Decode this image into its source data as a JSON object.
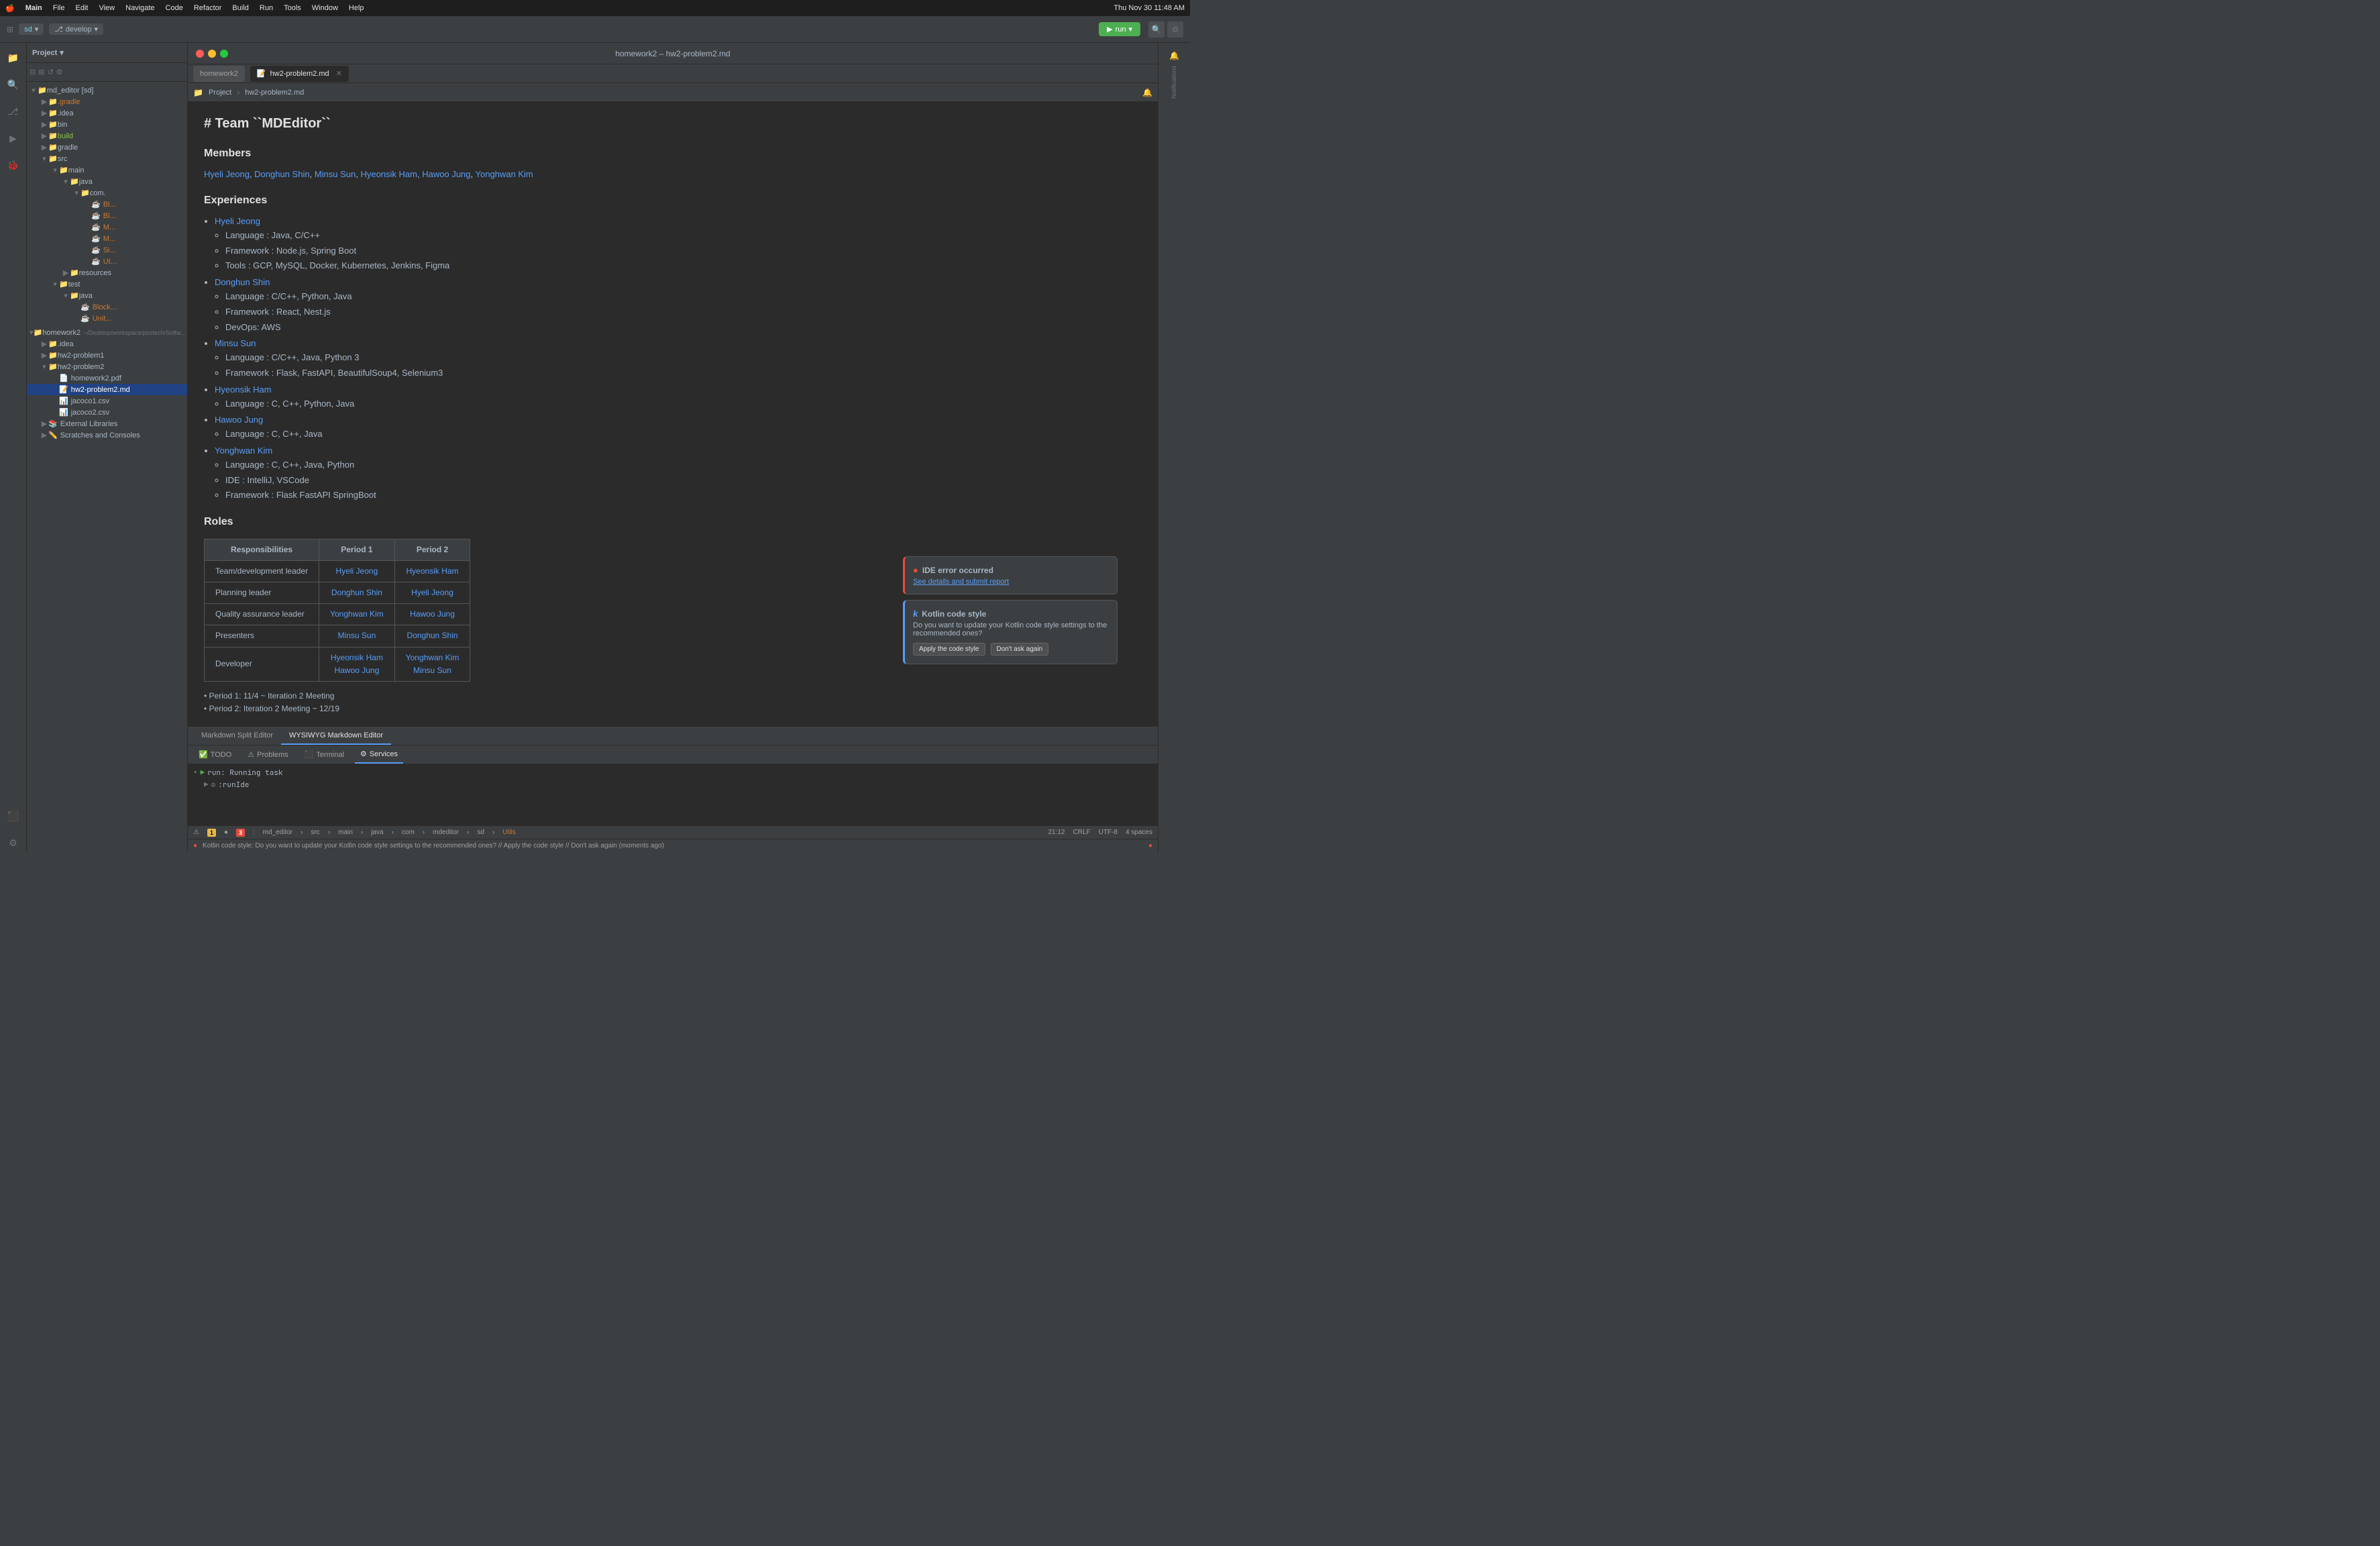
{
  "menubar": {
    "apple": "🍎",
    "items": [
      "Main",
      "File",
      "Edit",
      "View",
      "Navigate",
      "Code",
      "Refactor",
      "Build",
      "Run",
      "Tools",
      "Window",
      "Help"
    ],
    "right": "Thu Nov 30  11:48 AM"
  },
  "toolbar": {
    "project_label": "sd",
    "branch_label": "develop",
    "run_label": "run",
    "run_icon": "▶"
  },
  "title_bar": {
    "title": "homework2 – hw2-problem2.md"
  },
  "file_tabs": [
    {
      "label": "homework2",
      "active": false
    },
    {
      "label": "hw2-problem2.md",
      "active": true
    }
  ],
  "breadcrumb": {
    "path": "hw2-problem2.md"
  },
  "editor_toolbar": {
    "project_path": "Project",
    "hw2_tab": "hw2-problem2.md"
  },
  "file_tree": {
    "header": "Project",
    "items": [
      {
        "label": "md_editor [sd]",
        "level": 0,
        "type": "root",
        "expanded": true
      },
      {
        "label": ".gradle",
        "level": 1,
        "type": "folder",
        "expanded": false
      },
      {
        "label": ".idea",
        "level": 1,
        "type": "folder",
        "expanded": false
      },
      {
        "label": "bin",
        "level": 1,
        "type": "folder",
        "expanded": false
      },
      {
        "label": "build",
        "level": 1,
        "type": "folder",
        "expanded": false,
        "highlight": true
      },
      {
        "label": "gradle",
        "level": 1,
        "type": "folder",
        "expanded": false
      },
      {
        "label": "src",
        "level": 1,
        "type": "folder",
        "expanded": true
      },
      {
        "label": "main",
        "level": 2,
        "type": "folder",
        "expanded": true
      },
      {
        "label": "java",
        "level": 3,
        "type": "folder",
        "expanded": true
      },
      {
        "label": "com...",
        "level": 4,
        "type": "folder",
        "expanded": true
      },
      {
        "label": "homework2",
        "level": 0,
        "type": "folder",
        "expanded": true,
        "root": true
      },
      {
        "label": ".idea",
        "level": 1,
        "type": "folder",
        "expanded": false
      },
      {
        "label": "hw2-problem1",
        "level": 1,
        "type": "folder",
        "expanded": false
      },
      {
        "label": "hw2-problem2",
        "level": 1,
        "type": "folder",
        "expanded": true
      },
      {
        "label": "homework2.pdf",
        "level": 2,
        "type": "pdf"
      },
      {
        "label": "hw2-problem2.md",
        "level": 2,
        "type": "md",
        "selected": true
      },
      {
        "label": "jacoco1.csv",
        "level": 2,
        "type": "csv"
      },
      {
        "label": "jacoco2.csv",
        "level": 2,
        "type": "csv"
      },
      {
        "label": "External Libraries",
        "level": 1,
        "type": "lib"
      },
      {
        "label": "Scratches and Consoles",
        "level": 1,
        "type": "scratch"
      }
    ]
  },
  "editor": {
    "title": "# Team ``MDEditor``",
    "members_heading": "Members",
    "members_list": "Hyeli Jeong, Donghun Shin, Minsu Sun, Hyeonsik Ham, Hawoo Jung, Yonghwan Kim",
    "experiences_heading": "Experiences",
    "experiences": [
      {
        "name": "Hyeli Jeong",
        "details": [
          "Language : Java, C/C++",
          "Framework : Node.js, Spring Boot",
          "Tools : GCP, MySQL, Docker, Kubernetes, Jenkins, Figma"
        ]
      },
      {
        "name": "Donghun Shin",
        "details": [
          "Language : C/C++, Python, Java",
          "Framework : React, Nest.js",
          "DevOps: AWS"
        ]
      },
      {
        "name": "Minsu Sun",
        "details": [
          "Language : C/C++, Java, Python 3",
          "Framework : Flask, FastAPI, BeautifulSoup4, Selenium3"
        ]
      },
      {
        "name": "Hyeonsik Ham",
        "details": [
          "Language : C, C++, Python, Java"
        ]
      },
      {
        "name": "Hawoo Jung",
        "details": [
          "Language : C, C++, Java"
        ]
      },
      {
        "name": "Yonghwan Kim",
        "details": [
          "Language : C, C++, Java, Python",
          "IDE : IntelliJ, VSCode",
          "Framework : Flask FastAPI SpringBoot"
        ]
      }
    ],
    "roles_heading": "Roles",
    "roles_table": {
      "headers": [
        "Responsibilities",
        "Period 1",
        "Period 2"
      ],
      "rows": [
        {
          "role": "Team/development leader",
          "p1": "Hyeli Jeong",
          "p2": "Hyeonsik Ham"
        },
        {
          "role": "Planning leader",
          "p1": "Donghun Shin",
          "p2": "Hyeli Jeong"
        },
        {
          "role": "Quality assurance leader",
          "p1": "Yonghwan Kim",
          "p2": "Hawoo Jung"
        },
        {
          "role": "Presenters",
          "p1": "Minsu Sun",
          "p2": "Donghun Shin"
        },
        {
          "role": "Developer",
          "p1": "Hyeonsik Ham\nHawoo Jung",
          "p2": "Yonghwan Kim\nMinsu Sun"
        }
      ]
    },
    "period_notes": [
      "• Period 1: 11/4 ~ Iteration 2 Meeting",
      "• Period 2: Iteration 2 Meeting ~ 12/19"
    ]
  },
  "bottom_editor_tabs": [
    {
      "label": "Markdown Split Editor",
      "active": false
    },
    {
      "label": "WYSIWYG Markdown Editor",
      "active": true
    }
  ],
  "run_panel": {
    "tabs": [
      {
        "label": "TODO",
        "active": false
      },
      {
        "label": "Problems",
        "active": false
      },
      {
        "label": "Terminal",
        "active": false
      },
      {
        "label": "Services",
        "active": true
      }
    ],
    "tree_items": [
      {
        "label": "run: Running task",
        "level": 0
      },
      {
        "label": ":runIde",
        "level": 1
      }
    ]
  },
  "status_bar": {
    "breadcrumbs": [
      "md_editor",
      "src",
      "main",
      "java",
      "com",
      "mdeditor",
      "sd",
      "Utils"
    ],
    "right": {
      "line_col": "21:12",
      "crlf": "CRLF",
      "encoding": "UTF-8",
      "indent": "4 spaces"
    },
    "warnings": "1",
    "errors": "3"
  },
  "notifications": {
    "error": {
      "title": "IDE error occurred",
      "link": "See details and submit report"
    },
    "kotlin": {
      "title": "Kotlin code style",
      "body": "Do you want to update your Kotlin code style settings to the recommended ones?",
      "apply_btn": "Apply the code style",
      "dismiss_btn": "Don't ask again"
    }
  },
  "bottom_bar": {
    "message": "Kotlin code style: Do you want to update your Kotlin code style settings to the recommended ones? // Apply the code style // Don't ask again (moments ago)"
  },
  "icons": {
    "folder": "📁",
    "file": "📄",
    "java": "☕",
    "md": "📝",
    "csv": "📊",
    "error": "●",
    "info": "k",
    "chevron_right": "›",
    "chevron_down": "▾",
    "run": "▶",
    "stop": "■",
    "reload": "↺"
  }
}
